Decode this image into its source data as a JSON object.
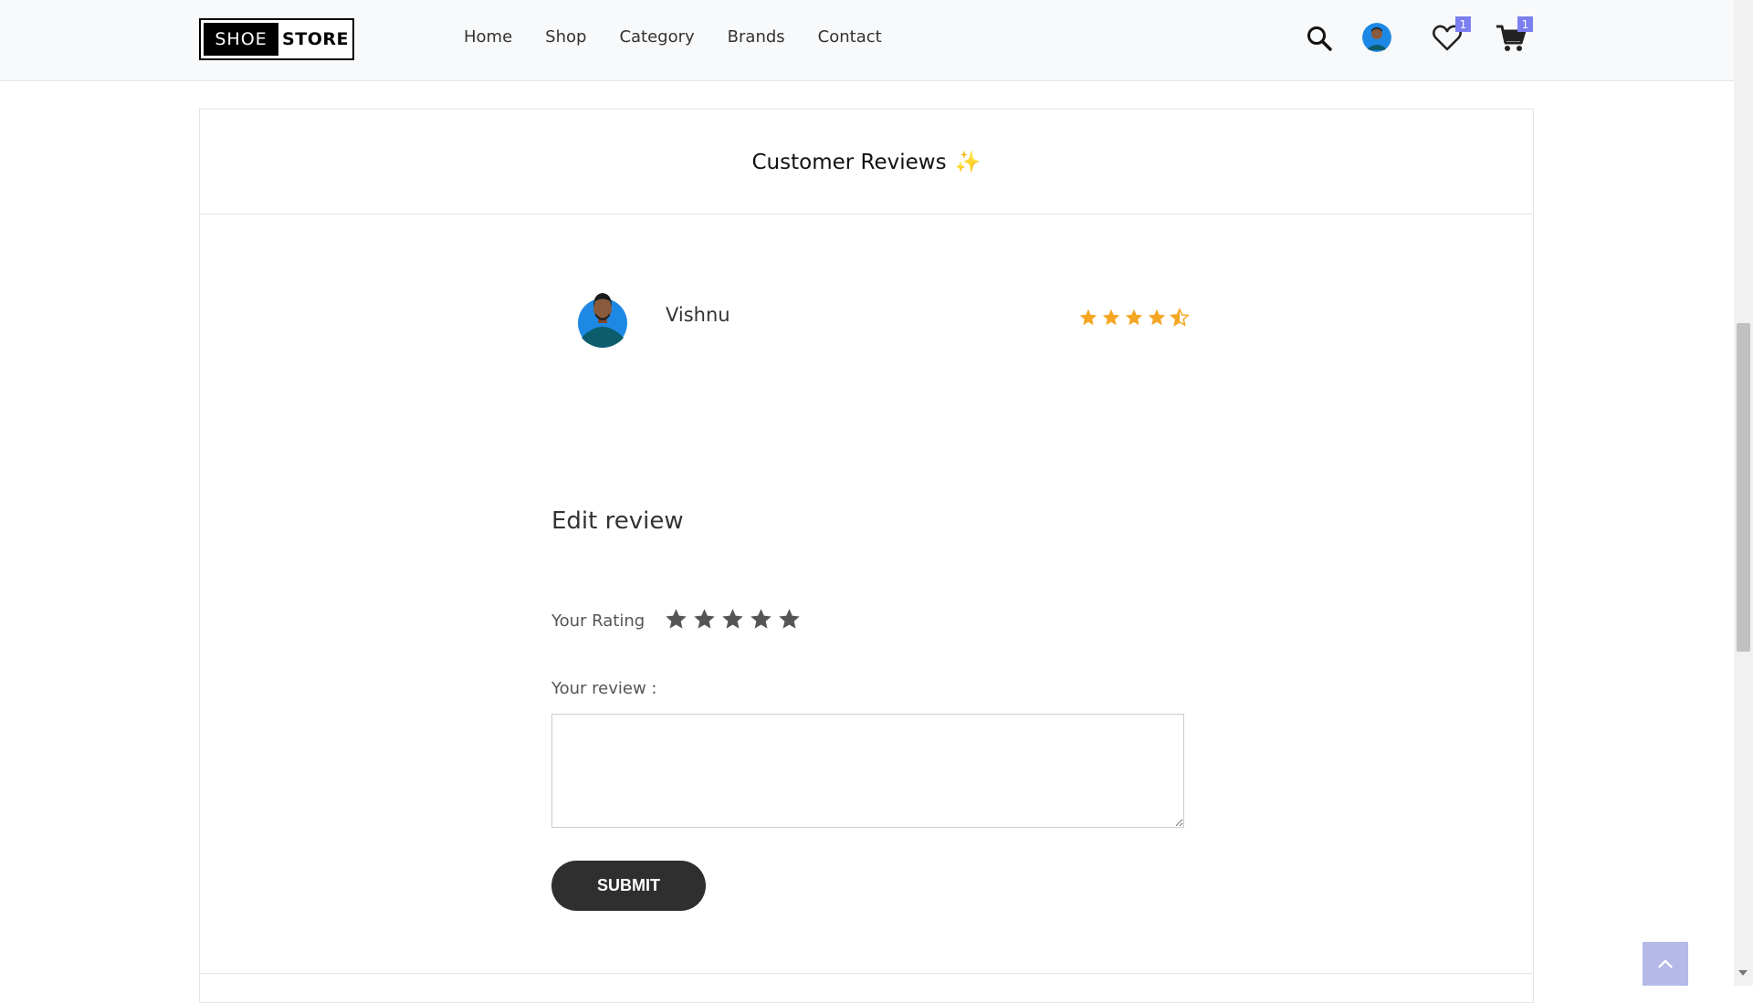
{
  "header": {
    "logo": {
      "word1": "SHOE",
      "word2": "STORE"
    },
    "nav": [
      "Home",
      "Shop",
      "Category",
      "Brands",
      "Contact"
    ],
    "wishlist_count": "1",
    "cart_count": "1",
    "icons": [
      "search-icon",
      "avatar",
      "heart-icon",
      "cart-icon"
    ]
  },
  "reviews": {
    "title": "Customer Reviews",
    "title_emoji": "✨",
    "items": [
      {
        "name": "Vishnu",
        "rating": 4.5
      }
    ]
  },
  "edit_review": {
    "title": "Edit review",
    "rating_label": "Your Rating",
    "rating_value": 0,
    "rating_max": 5,
    "review_label": "Your review :",
    "review_value": "",
    "submit_label": "SUBMIT"
  },
  "colors": {
    "accent": "#7b7ff0",
    "star_filled": "#f5a623",
    "star_input": "#555555",
    "button_bg": "#2f2f2f",
    "back_to_top": "#b4b9e8"
  }
}
